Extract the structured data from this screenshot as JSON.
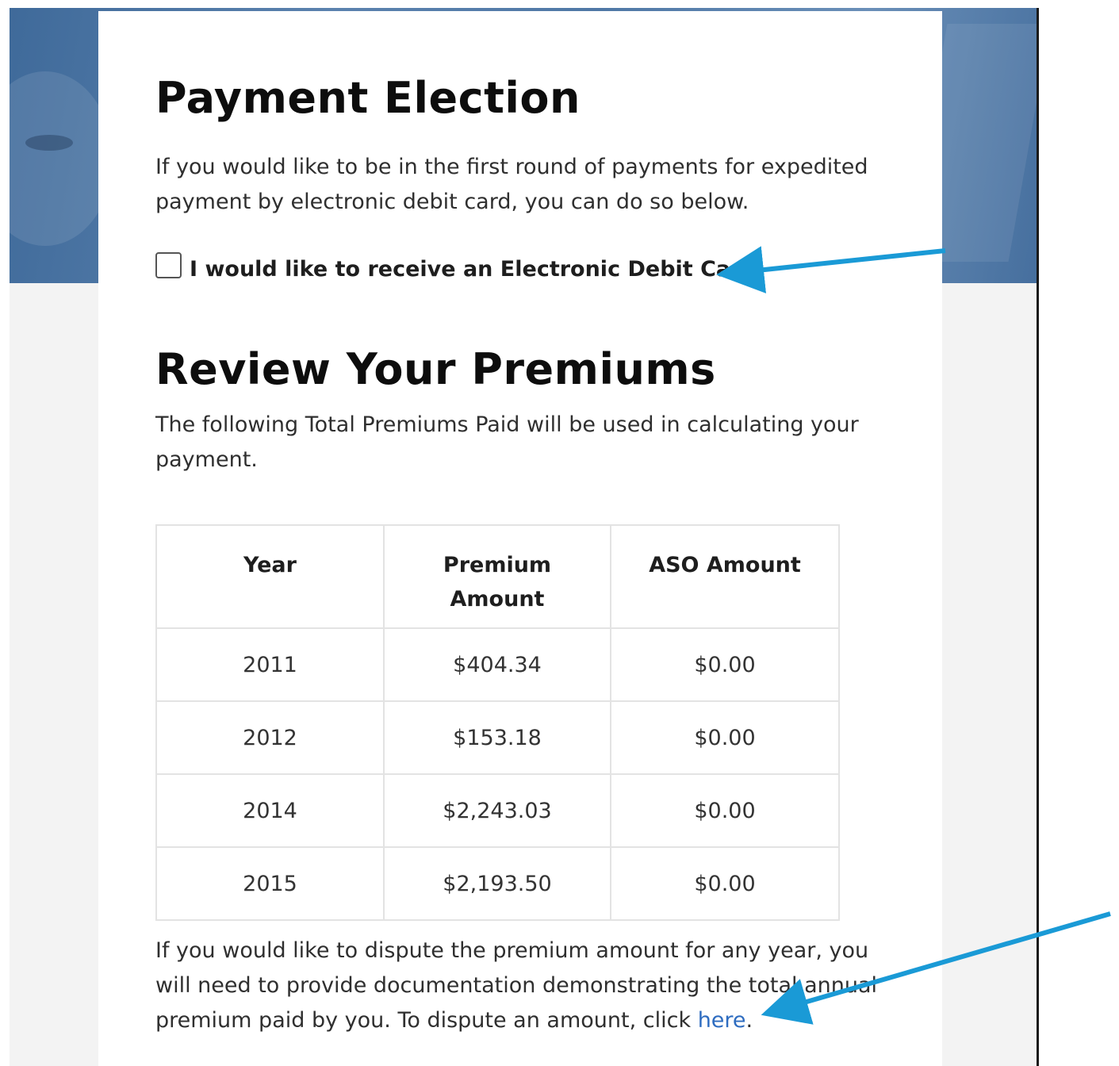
{
  "payment_election": {
    "title": "Payment Election",
    "description": "If you would like to be in the first round of payments for expedited payment by electronic debit card, you can do so below.",
    "checkbox_label": "I would like to receive an Electronic Debit Card",
    "checkbox_checked": false
  },
  "review": {
    "title": "Review Your Premiums",
    "description": "The following Total Premiums Paid will be used in calculating your payment.",
    "table": {
      "headers": [
        "Year",
        "Premium Amount",
        "ASO Amount"
      ],
      "rows": [
        [
          "2011",
          "$404.34",
          "$0.00"
        ],
        [
          "2012",
          "$153.18",
          "$0.00"
        ],
        [
          "2014",
          "$2,243.03",
          "$0.00"
        ],
        [
          "2015",
          "$2,193.50",
          "$0.00"
        ]
      ]
    },
    "dispute_text": "If you would like to dispute the premium amount for any year, you will need to provide documentation demonstrating the total annual premium paid by you. To dispute an amount, click ",
    "dispute_link": "here",
    "dispute_end": "."
  },
  "colors": {
    "annotation_arrow": "#1a9ad6",
    "link": "#2e6cc0",
    "hero": "#4f78a6"
  }
}
